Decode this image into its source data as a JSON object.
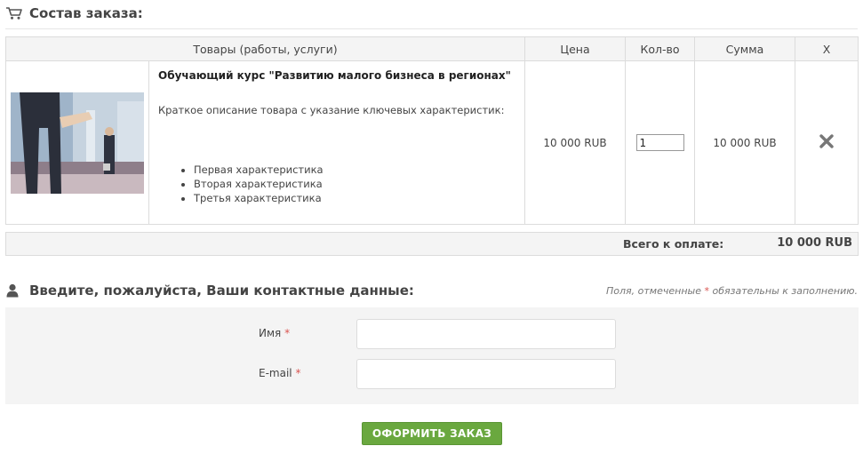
{
  "order": {
    "title": "Состав заказа:",
    "columns": {
      "goods": "Товары (работы, услуги)",
      "price": "Цена",
      "qty": "Кол-во",
      "sum": "Сумма",
      "remove": "X"
    },
    "item": {
      "name": "Обучающий курс \"Развитию малого бизнеса в регионах\"",
      "description": "Краткое описание товара с указание ключевых характеристик:",
      "features": [
        "Первая характеристика",
        "Вторая характеристика",
        "Третья характеристика"
      ],
      "price": "10 000 RUB",
      "quantity": "1",
      "sum": "10 000 RUB",
      "image_icon": "business-handshake-photo"
    },
    "total_label": "Всего к оплате:",
    "total_value": "10 000 RUB"
  },
  "contact": {
    "title": "Введите, пожалуйста, Ваши контактные данные:",
    "note_prefix": "Поля, отмеченные",
    "note_star": "*",
    "note_suffix": "обязательны к заполнению.",
    "name_label": "Имя",
    "email_label": "E-mail",
    "required_mark": "*",
    "name_value": "",
    "email_value": ""
  },
  "submit_label": "ОФОРМИТЬ ЗАКАЗ",
  "colors": {
    "accent_green": "#6aa83f",
    "required_red": "#d9534f",
    "panel_gray": "#f4f4f4"
  }
}
